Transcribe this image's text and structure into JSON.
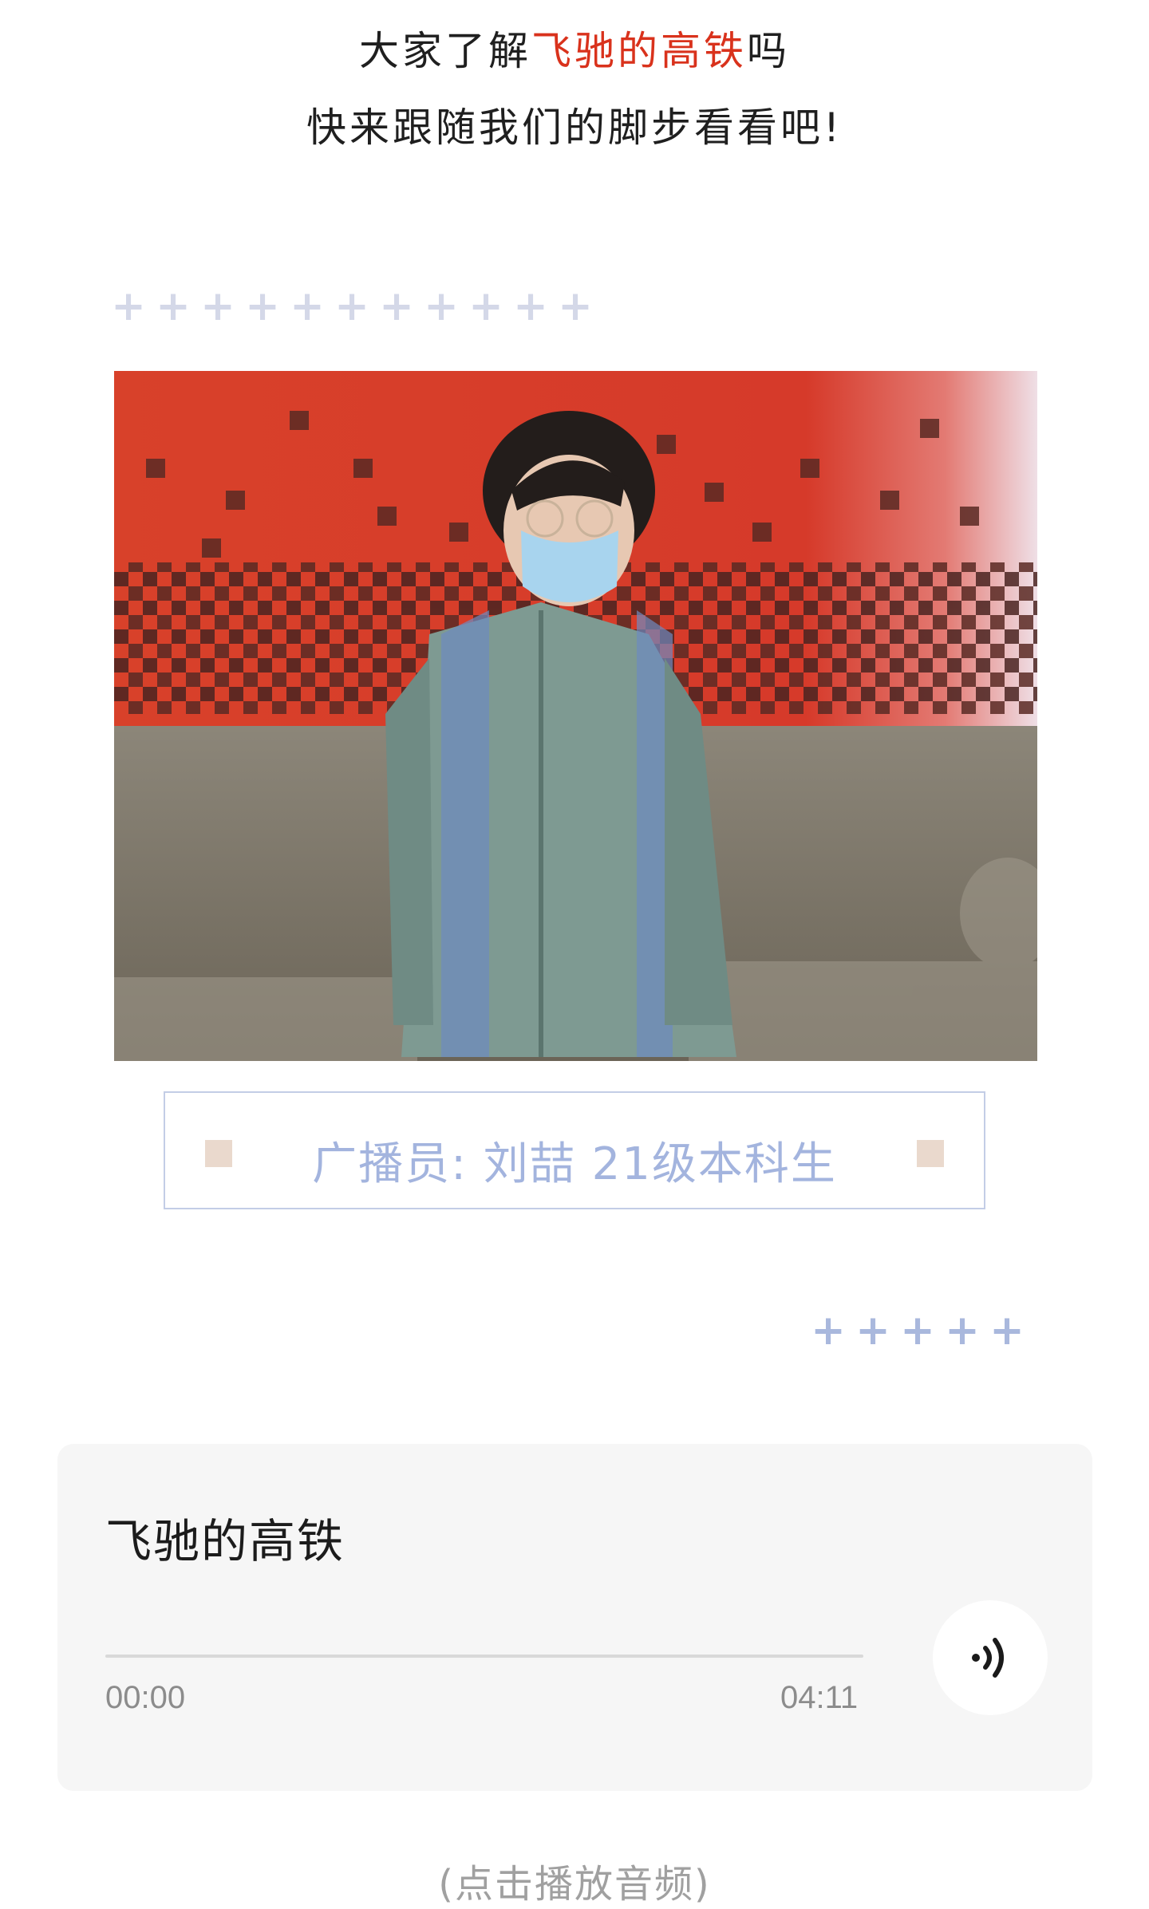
{
  "intro": {
    "line1_prefix": "大家了解",
    "line1_highlight": "飞驰的高铁",
    "line1_suffix": "吗",
    "line2": "快来跟随我们的脚步看看吧!"
  },
  "decor": {
    "top_plus": [
      "+",
      "+",
      "+",
      "+",
      "+",
      "+",
      "+",
      "+",
      "+",
      "+",
      "+"
    ],
    "bottom_plus": [
      "+",
      "+",
      "+",
      "+",
      "+"
    ]
  },
  "photo": {
    "description_icon": "portrait-photo"
  },
  "caption": {
    "text": "广播员: 刘喆 21级本科生"
  },
  "audio": {
    "title": "飞驰的高铁",
    "current_time": "00:00",
    "total_time": "04:11",
    "progress": 0,
    "play_icon": "sound-wave-icon"
  },
  "hint": "(点击播放音频)",
  "colors": {
    "highlight": "#d9321c",
    "caption_text": "#a3b4de",
    "caption_border": "#c3cde6",
    "card_bg": "#f6f6f6"
  }
}
